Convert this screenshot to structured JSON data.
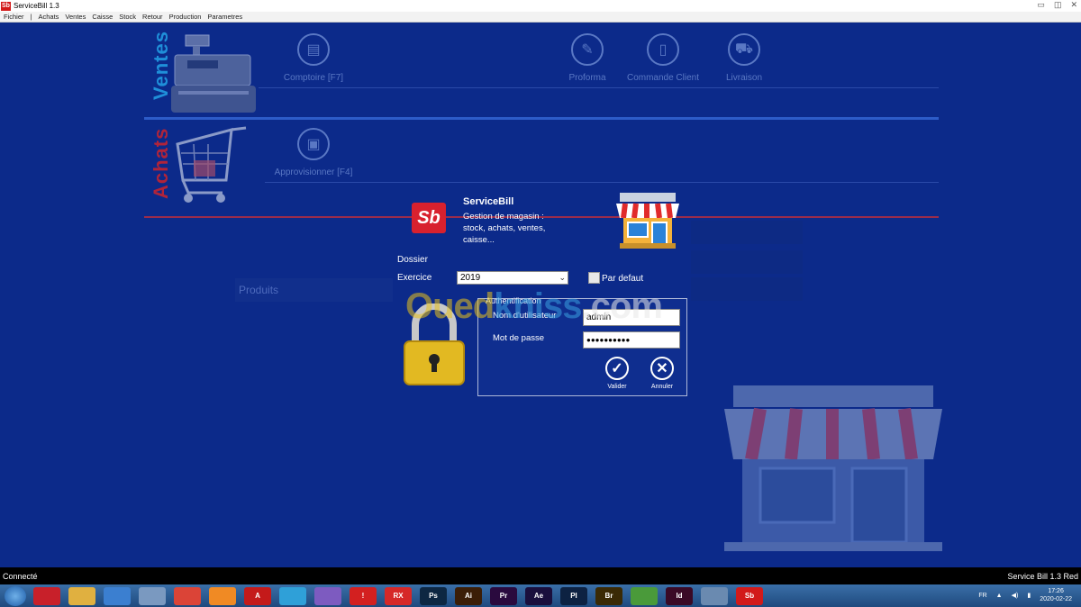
{
  "window": {
    "title": "ServiceBill 1.3",
    "logo": "Sb"
  },
  "menu": [
    "Fichier",
    "|",
    "Achats",
    "Ventes",
    "Caisse",
    "Stock",
    "Retour",
    "Production",
    "Parametres"
  ],
  "sections": {
    "ventes": {
      "label": "Ventes",
      "color": "#1f8fd9"
    },
    "achats": {
      "label": "Achats",
      "color": "#b0243a"
    }
  },
  "modules": {
    "comptoir": "Comptoire [F7]",
    "proforma": "Proforma",
    "commande": "Commande Client",
    "livraison": "Livraison",
    "approvisionner": "Approvisionner [F4]",
    "produits": "Produits"
  },
  "login": {
    "app_name": "ServiceBill",
    "desc1": "Gestion de magasin :",
    "desc2": "stock, achats, ventes,",
    "desc3": "caisse...",
    "dossier_label": "Dossier",
    "exercice_label": "Exercice",
    "exercice_value": "2019",
    "default_label": "Par defaut",
    "auth_label": "Authentification",
    "user_label": "Nom d'utilisateur",
    "user_value": "admin",
    "password_label": "Mot de passe",
    "password_value": "●●●●●●●●●●",
    "validate_label": "Valider",
    "cancel_label": "Annuler"
  },
  "watermark": {
    "part1": "Oued",
    "part2": "kniss",
    "part3": ".com"
  },
  "status": {
    "left": "Connecté",
    "right": "Service Bill 1.3 Red"
  },
  "taskbar": {
    "apps": [
      {
        "label": "",
        "color": "#c8202a"
      },
      {
        "label": "",
        "color": "#e0b040"
      },
      {
        "label": "",
        "color": "#3b7fd0"
      },
      {
        "label": "",
        "color": "#7a99c0"
      },
      {
        "label": "",
        "color": "#db4437"
      },
      {
        "label": "",
        "color": "#f08a24"
      },
      {
        "label": "A",
        "color": "#c41a1a"
      },
      {
        "label": "",
        "color": "#2fa0d8"
      },
      {
        "label": "",
        "color": "#7d5bc0"
      },
      {
        "label": "!",
        "color": "#d32020"
      },
      {
        "label": "RX",
        "color": "#d62828"
      },
      {
        "label": "Ps",
        "color": "#0d2742"
      },
      {
        "label": "Ai",
        "color": "#3b1e07"
      },
      {
        "label": "Pr",
        "color": "#2a0a3e"
      },
      {
        "label": "Ae",
        "color": "#1a0f3d"
      },
      {
        "label": "Pl",
        "color": "#0d2242"
      },
      {
        "label": "Br",
        "color": "#3a2a05"
      },
      {
        "label": "",
        "color": "#4a9a3a"
      },
      {
        "label": "Id",
        "color": "#3a0a26"
      },
      {
        "label": "",
        "color": "#6a8ab0"
      },
      {
        "label": "Sb",
        "color": "#d21a1a"
      }
    ],
    "lang": "FR",
    "time": "17:26",
    "date": "2020-02-22"
  }
}
